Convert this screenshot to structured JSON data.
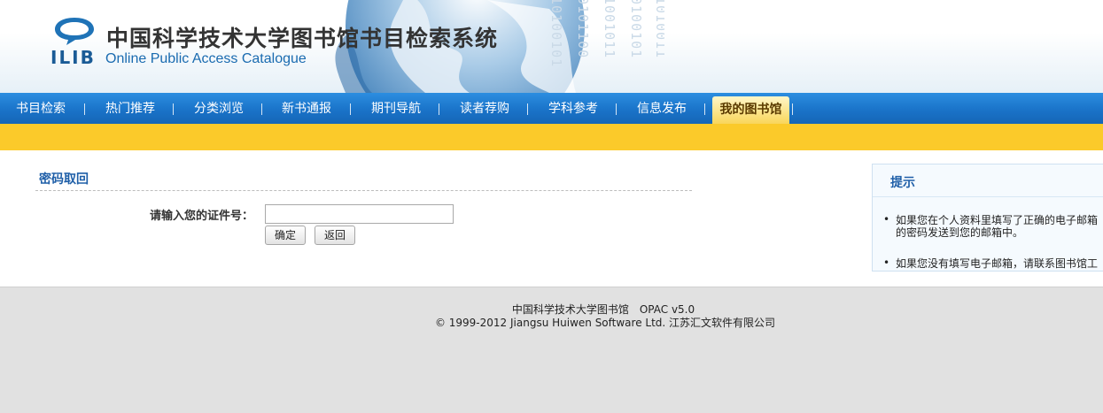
{
  "header": {
    "logo_text": "ILIB",
    "title_cn": "中国科学技术大学图书馆书目检索系统",
    "title_en": "Online Public Access Catalogue"
  },
  "nav": {
    "items": [
      {
        "label": "书目检索"
      },
      {
        "label": "热门推荐"
      },
      {
        "label": "分类浏览"
      },
      {
        "label": "新书通报"
      },
      {
        "label": "期刊导航"
      },
      {
        "label": "读者荐购"
      },
      {
        "label": "学科参考"
      },
      {
        "label": "信息发布"
      },
      {
        "label": "我的图书馆",
        "active": true
      }
    ]
  },
  "main": {
    "section_title": "密码取回",
    "form_label": "请输入您的证件号：",
    "input_value": "",
    "confirm_label": "确定",
    "back_label": "返回"
  },
  "tips": {
    "title": "提示",
    "items": [
      {
        "line1": "如果您在个人资料里填写了正确的电子邮箱",
        "line2": "的密码发送到您的邮箱中。"
      },
      {
        "line1": "如果您没有填写电子邮箱，请联系图书馆工",
        "line2": ""
      }
    ]
  },
  "footer": {
    "line1": "中国科学技术大学图书馆　OPAC v5.0",
    "line2": "© 1999-2012 Jiangsu Huiwen Software Ltd. 江苏汇文软件有限公司"
  },
  "colors": {
    "nav_blue": "#1a73c9",
    "accent_yellow": "#fbca2a",
    "link_blue": "#1f5fa8"
  }
}
